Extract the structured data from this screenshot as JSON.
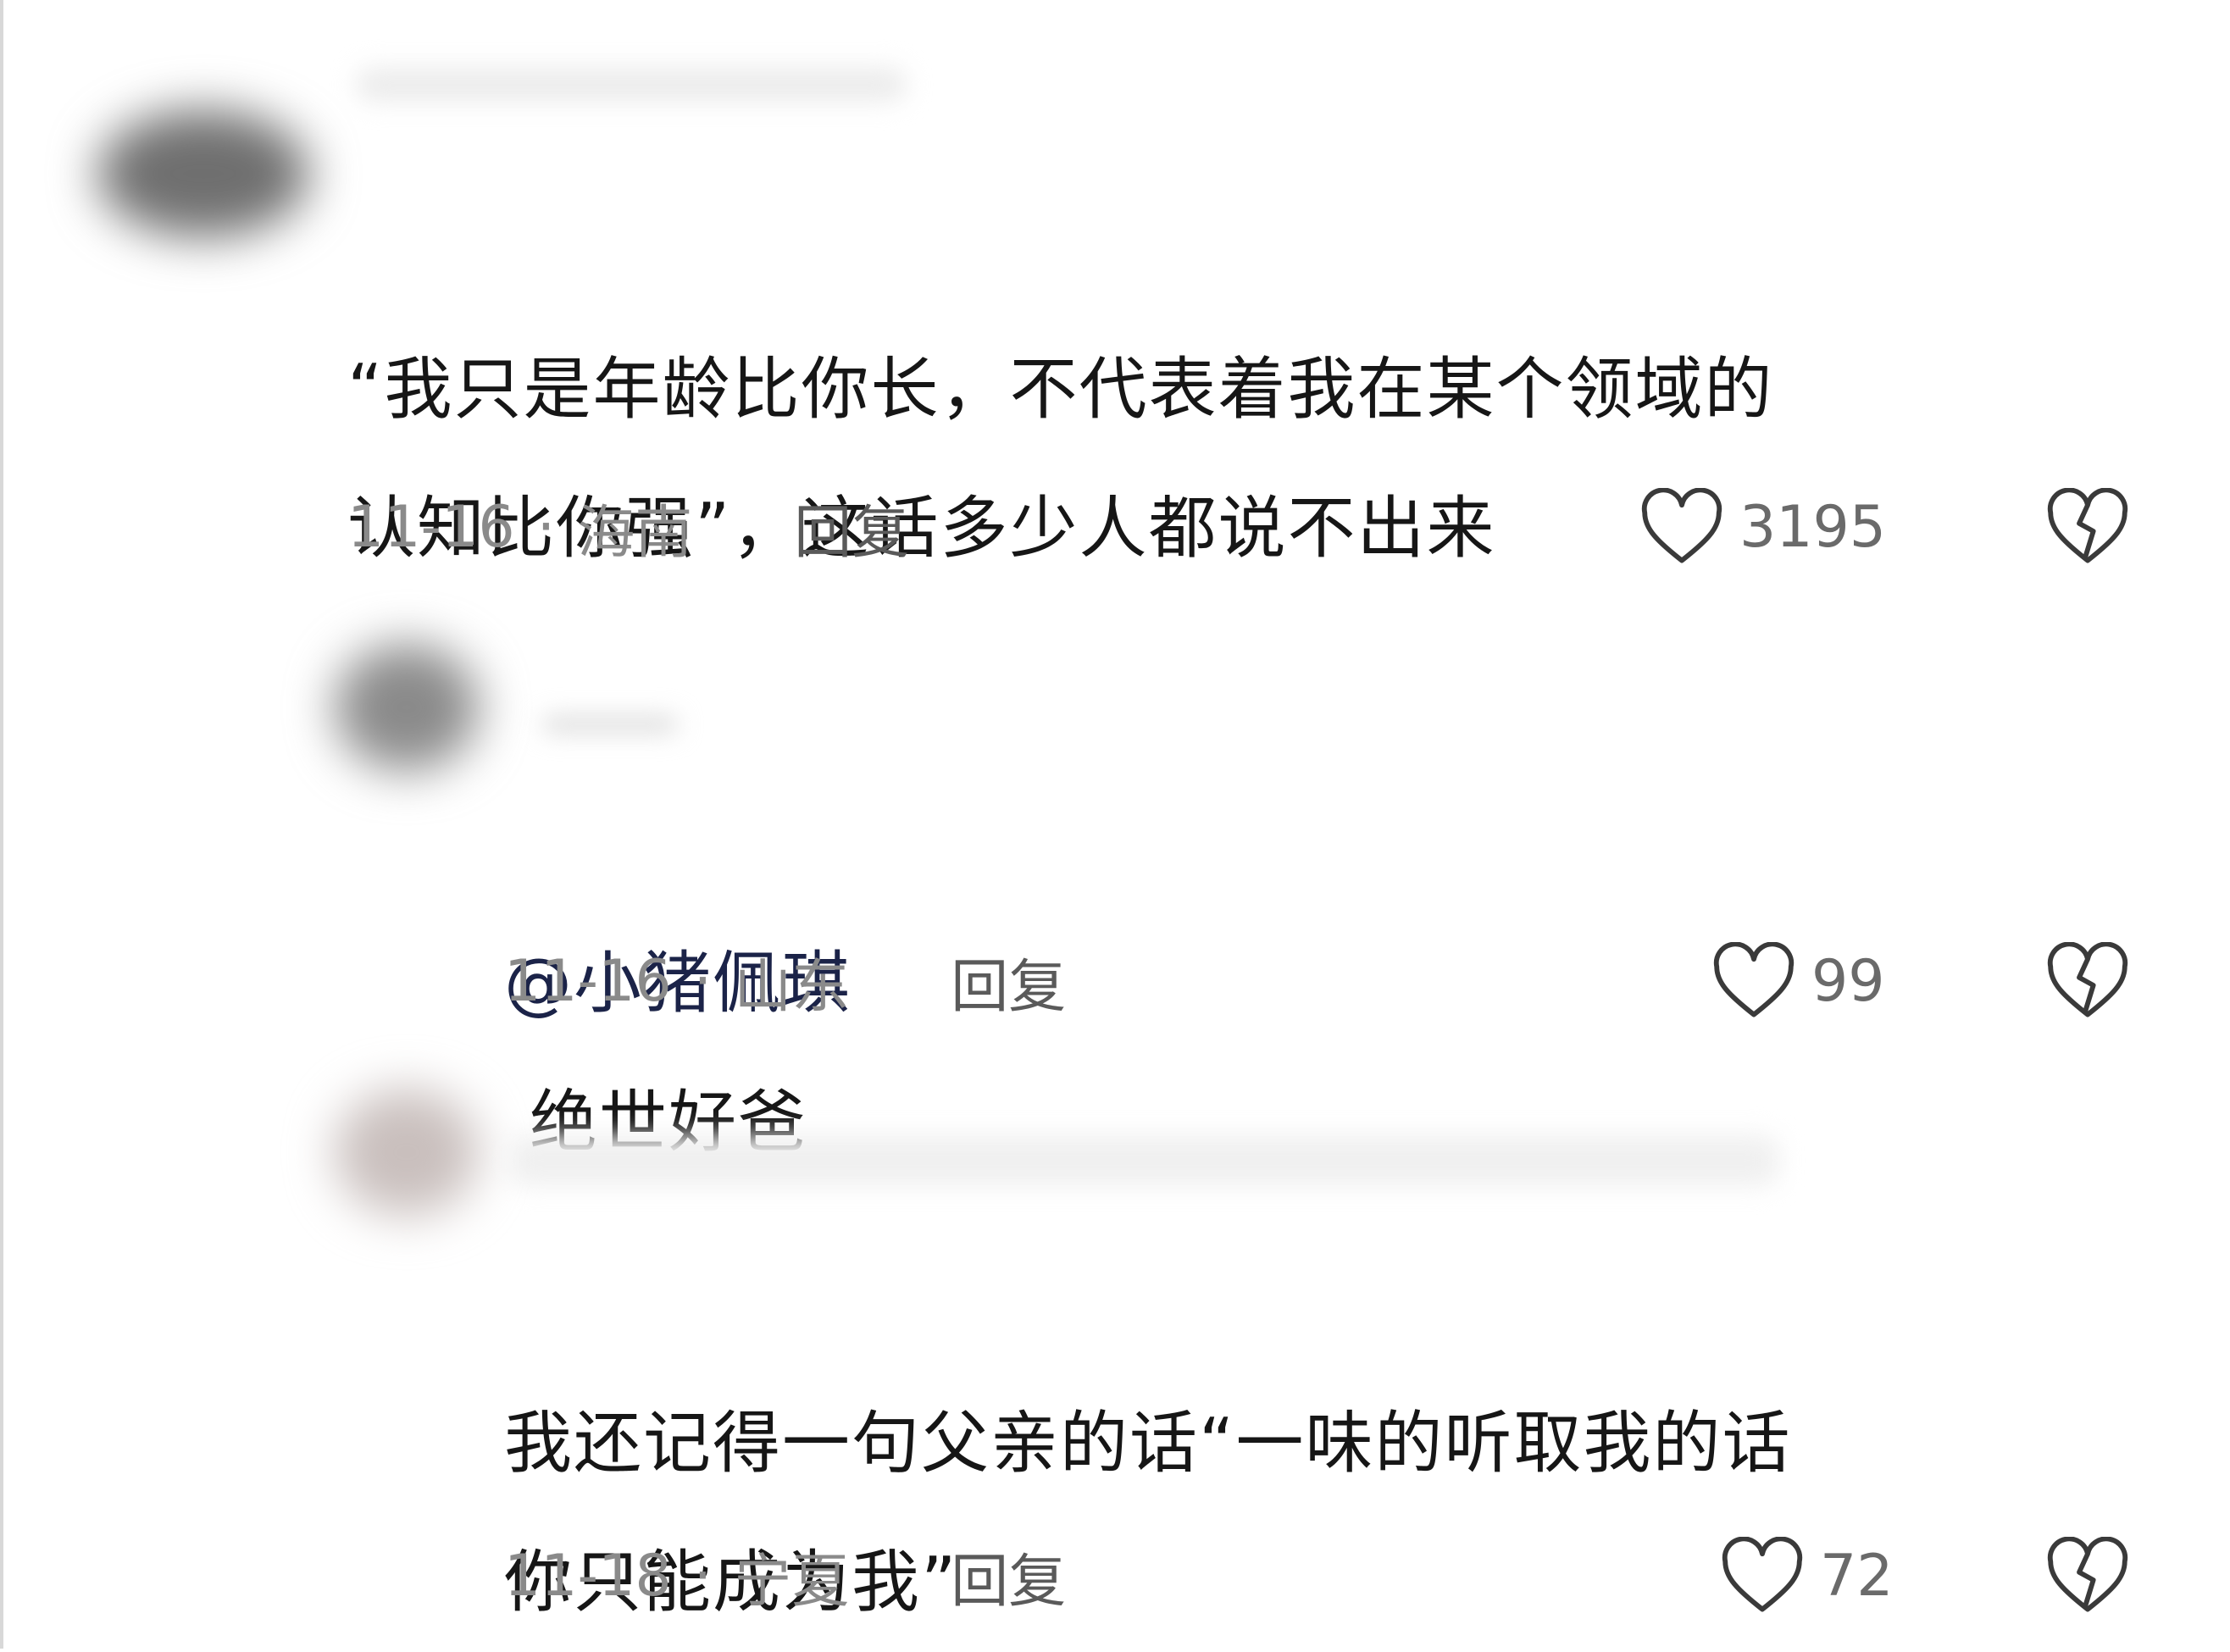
{
  "comments": [
    {
      "text": "“我只是年龄比你长，不代表着我在某个领域的\n认知比你强”，这话多少人都说不出来",
      "mention": "",
      "date": "11-16",
      "location": "海南",
      "reply_label": "回复",
      "likes": "3195"
    },
    {
      "text": "绝世好爸",
      "mention": "@小猪佩琪",
      "date": "11-16",
      "location": "山东",
      "reply_label": "回复",
      "likes": "99"
    },
    {
      "text": "我还记得一句父亲的话“一味的听取我的话\n你只能成为我”",
      "mention": "",
      "date": "11-18",
      "location": "宁夏",
      "reply_label": "回复",
      "likes": "72"
    }
  ],
  "icons": {
    "like": "heart-outline-icon",
    "dislike": "broken-heart-icon"
  },
  "colors": {
    "text": "#161616",
    "meta": "#8a8a8a",
    "mention": "#1b2348",
    "icon": "#3a3a3a"
  }
}
